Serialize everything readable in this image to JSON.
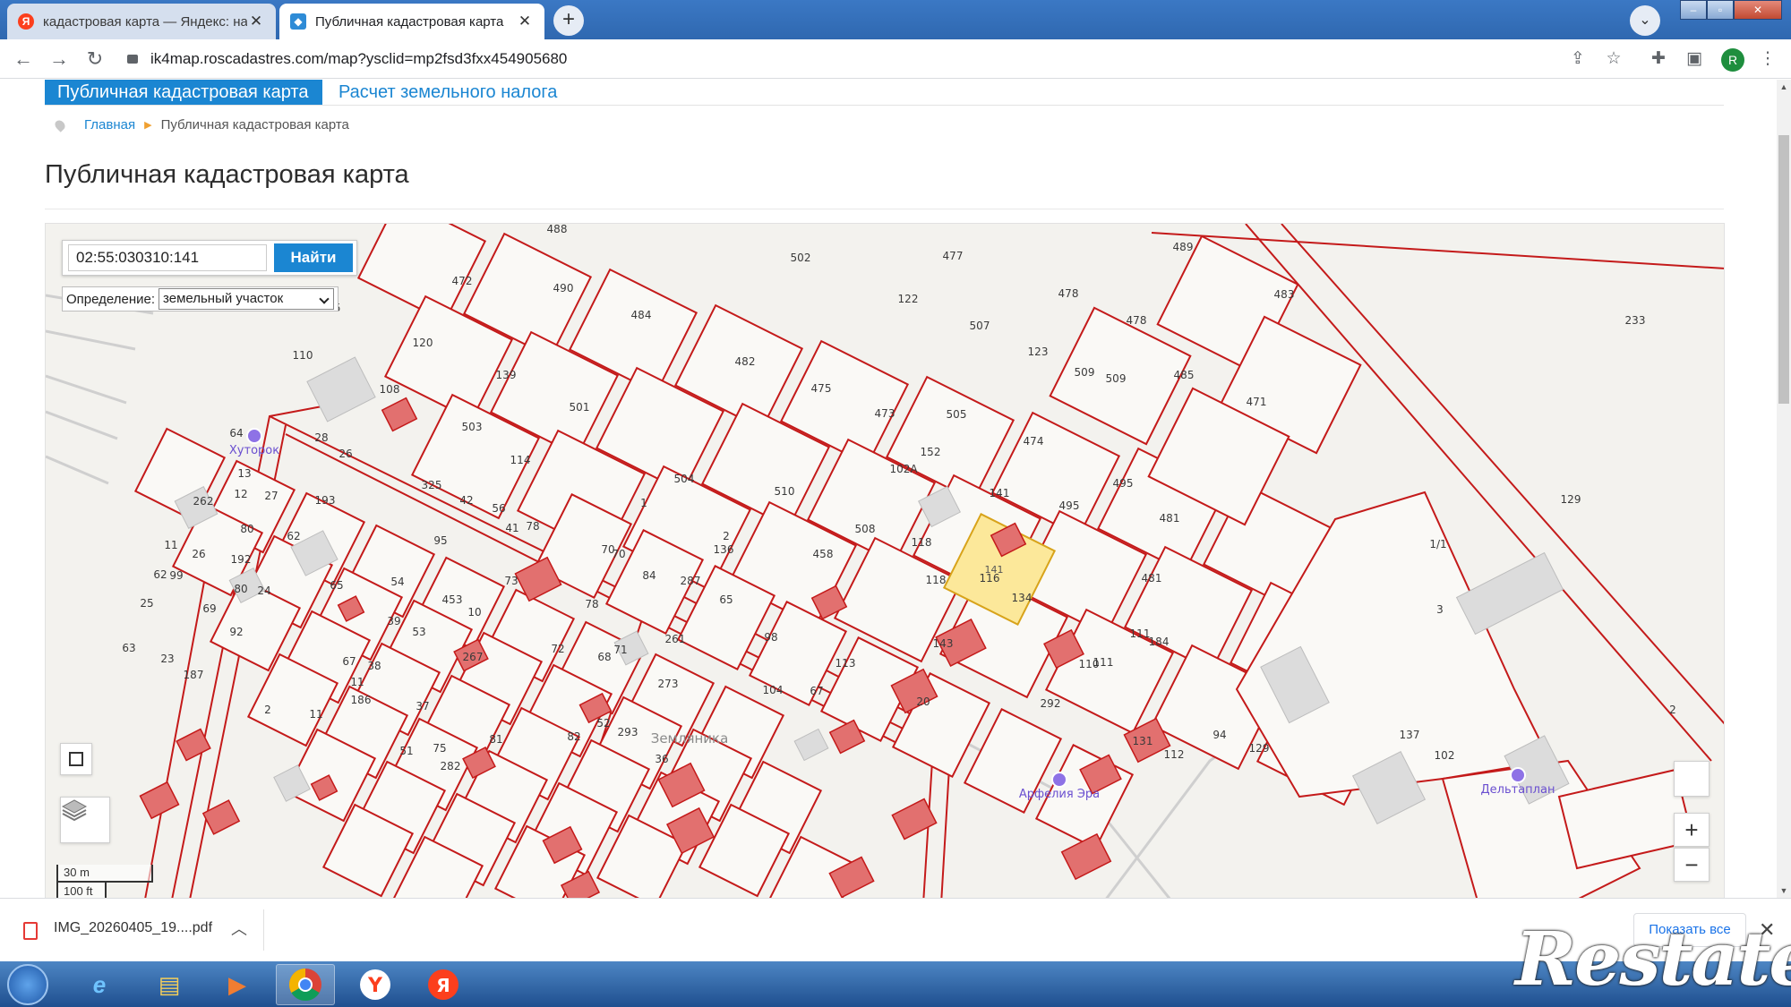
{
  "browser": {
    "tabs": [
      {
        "title": "кадастровая карта — Яндекс: на",
        "favicon": "yandex-icon"
      },
      {
        "title": "Публичная кадастровая карта",
        "favicon": "rosreestr-icon"
      }
    ],
    "new_tab_label": "+",
    "url": "ik4map.roscadastres.com/map?ysclid=mp2fsd3fxx454905680",
    "profile_initial": "R"
  },
  "page": {
    "top_tabs": [
      "Публичная кадастровая карта",
      "Расчет земельного налога"
    ],
    "breadcrumb": {
      "home": "Главная",
      "current": "Публичная кадастровая карта"
    },
    "title": "Публичная кадастровая карта"
  },
  "map": {
    "search_value": "02:55:030310:141",
    "search_button": "Найти",
    "definition_label": "Определение:",
    "definition_value": "земельный участок",
    "scale_m": "30 m",
    "scale_ft": "100 ft",
    "zoom_in": "+",
    "zoom_out": "−",
    "highlighted_parcel": "141",
    "highlight_color": "#fce89a",
    "boundary_color": "#c41a1a",
    "poi": [
      "Хуторок",
      "Дельтаплан",
      "Арфелия Эра"
    ],
    "area_name": "Земляника",
    "parcel_labels": [
      "488",
      "472",
      "490",
      "484",
      "502",
      "477",
      "489",
      "483",
      "122",
      "507",
      "478",
      "478",
      "233",
      "115",
      "120",
      "110",
      "482",
      "475",
      "473",
      "505",
      "474",
      "485",
      "471",
      "123",
      "509",
      "509",
      "108",
      "139",
      "501",
      "503",
      "114",
      "26",
      "28",
      "64",
      "13",
      "262",
      "12",
      "27",
      "193",
      "325",
      "42",
      "56",
      "504",
      "510",
      "152",
      "102А",
      "141",
      "495",
      "495",
      "481",
      "481",
      "1",
      "2",
      "136",
      "508",
      "118",
      "118",
      "116",
      "134",
      "458",
      "41",
      "95",
      "62",
      "11",
      "26",
      "80",
      "192",
      "78",
      "70",
      "70",
      "73",
      "78",
      "84",
      "287",
      "65",
      "65",
      "54",
      "453",
      "10",
      "62",
      "99",
      "25",
      "80",
      "24",
      "69",
      "92",
      "39",
      "53",
      "261",
      "72",
      "71",
      "98",
      "113",
      "143",
      "111",
      "111",
      "63",
      "23",
      "187",
      "67",
      "38",
      "267",
      "68",
      "273",
      "104",
      "67",
      "20",
      "292",
      "110",
      "184",
      "94",
      "131",
      "112",
      "129",
      "137",
      "102",
      "3",
      "1/1",
      "129",
      "2",
      "2",
      "11",
      "11",
      "186",
      "37",
      "52",
      "82",
      "81",
      "75",
      "282",
      "293",
      "36",
      "51",
      "270",
      "261"
    ]
  },
  "download": {
    "filename": "IMG_20260405_19....pdf",
    "show_all": "Показать все"
  },
  "watermark": "Restate"
}
